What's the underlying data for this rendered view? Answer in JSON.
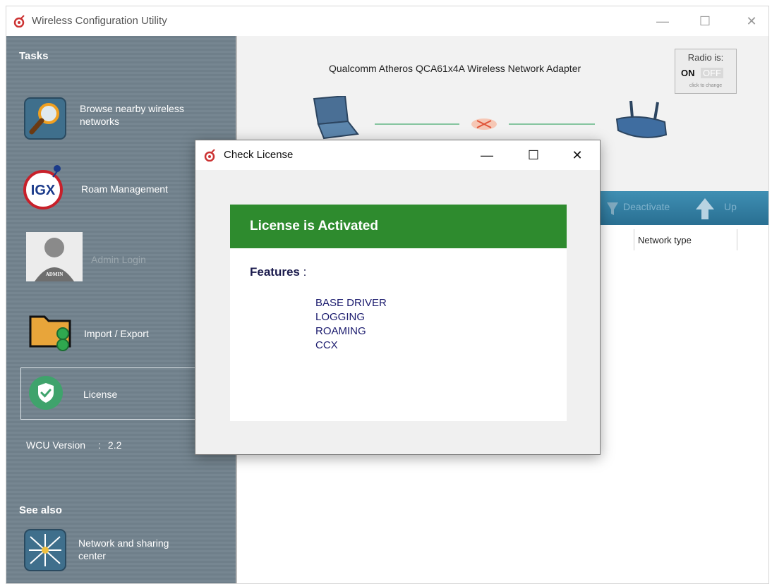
{
  "window": {
    "title": "Wireless Configuration Utility",
    "controls": {
      "minimize": "—",
      "maximize": "☐",
      "close": "✕"
    }
  },
  "sidebar": {
    "tasks_heading": "Tasks",
    "items": [
      {
        "label_line1": "Browse nearby wireless",
        "label_line2": "networks",
        "icon": "magnifier-icon"
      },
      {
        "label": "Roam Management",
        "icon": "igx-logo-icon"
      },
      {
        "label": "Admin Login",
        "icon": "admin-avatar-icon",
        "disabled": true
      },
      {
        "label": "Import / Export",
        "icon": "folder-icon"
      },
      {
        "label": "License",
        "icon": "shield-check-icon",
        "selected": true
      }
    ],
    "version_label": "WCU Version",
    "version_sep": ":",
    "version_value": "2.2",
    "see_also_heading": "See also",
    "see_also_item_line1": "Network and sharing",
    "see_also_item_line2": "center"
  },
  "main": {
    "adapter_name": "Qualcomm Atheros QCA61x4A Wireless Network Adapter",
    "radio": {
      "title": "Radio is:",
      "on": "ON",
      "off": "OFF",
      "hint": "click to change"
    },
    "toolbar": {
      "deactivate": "Deactivate",
      "up": "Up"
    },
    "column_network_type": "Network type"
  },
  "dialog": {
    "title": "Check License",
    "controls": {
      "minimize": "—",
      "maximize": "☐",
      "close": "✕"
    },
    "banner": "License is Activated",
    "features_title": "Features",
    "features_colon": ":",
    "features": [
      "BASE DRIVER",
      "LOGGING",
      "ROAMING",
      "CCX"
    ]
  },
  "colors": {
    "sidebar_bg": "#6f7f8a",
    "banner_green": "#2e8b2e",
    "toolbar_blue": "#296f92",
    "feature_text": "#1b1b6e"
  }
}
